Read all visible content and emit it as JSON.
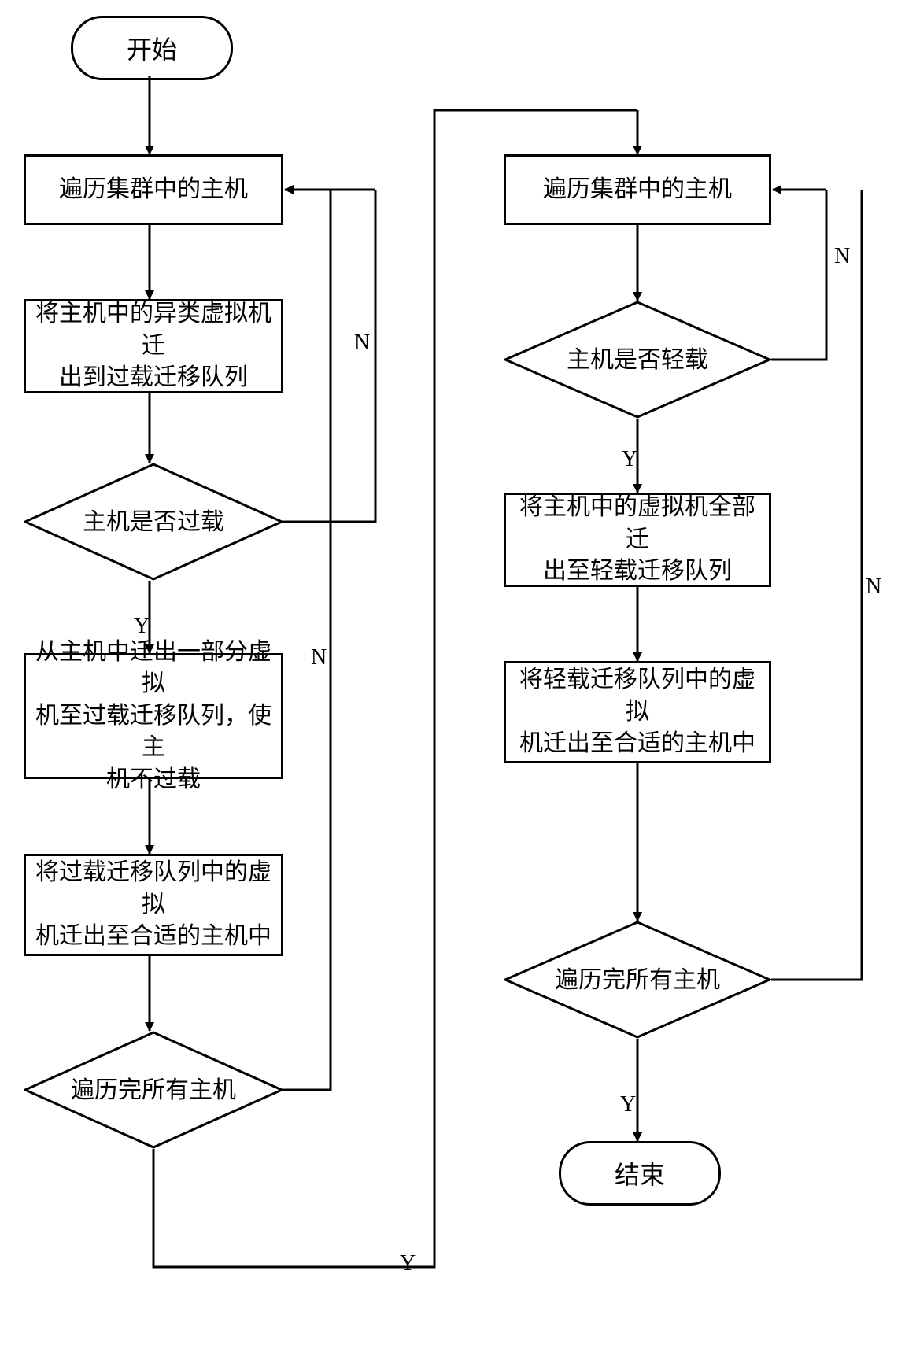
{
  "nodes": {
    "start": "开始",
    "end": "结束",
    "l_traverse": "遍历集群中的主机",
    "l_move_hetero": "将主机中的异类虚拟机迁\n出到过载迁移队列",
    "l_overloaded": "主机是否过载",
    "l_move_some": "从主机中迁出一部分虚拟\n机至过载迁移队列，使主\n机不过载",
    "l_move_overload_q": "将过载迁移队列中的虚拟\n机迁出至合适的主机中",
    "l_done_all": "遍历完所有主机",
    "r_traverse": "遍历集群中的主机",
    "r_lightload": "主机是否轻载",
    "r_move_all": "将主机中的虚拟机全部迁\n出至轻载迁移队列",
    "r_move_light_q": "将轻载迁移队列中的虚拟\n机迁出至合适的主机中",
    "r_done_all": "遍历完所有主机"
  },
  "labels": {
    "Y": "Y",
    "N": "N"
  },
  "chart_data": {
    "type": "flowchart",
    "title": "",
    "start": "start",
    "end": "end",
    "nodes": [
      {
        "id": "start",
        "type": "terminator",
        "text": "开始"
      },
      {
        "id": "l_traverse",
        "type": "process",
        "text": "遍历集群中的主机"
      },
      {
        "id": "l_move_hetero",
        "type": "process",
        "text": "将主机中的异类虚拟机迁出到过载迁移队列"
      },
      {
        "id": "l_overloaded",
        "type": "decision",
        "text": "主机是否过载"
      },
      {
        "id": "l_move_some",
        "type": "process",
        "text": "从主机中迁出一部分虚拟机至过载迁移队列，使主机不过载"
      },
      {
        "id": "l_move_overload_q",
        "type": "process",
        "text": "将过载迁移队列中的虚拟机迁出至合适的主机中"
      },
      {
        "id": "l_done_all",
        "type": "decision",
        "text": "遍历完所有主机"
      },
      {
        "id": "r_traverse",
        "type": "process",
        "text": "遍历集群中的主机"
      },
      {
        "id": "r_lightload",
        "type": "decision",
        "text": "主机是否轻载"
      },
      {
        "id": "r_move_all",
        "type": "process",
        "text": "将主机中的虚拟机全部迁出至轻载迁移队列"
      },
      {
        "id": "r_move_light_q",
        "type": "process",
        "text": "将轻载迁移队列中的虚拟机迁出至合适的主机中"
      },
      {
        "id": "r_done_all",
        "type": "decision",
        "text": "遍历完所有主机"
      },
      {
        "id": "end",
        "type": "terminator",
        "text": "结束"
      }
    ],
    "edges": [
      {
        "from": "start",
        "to": "l_traverse"
      },
      {
        "from": "l_traverse",
        "to": "l_move_hetero"
      },
      {
        "from": "l_move_hetero",
        "to": "l_overloaded"
      },
      {
        "from": "l_overloaded",
        "to": "l_move_some",
        "label": "Y"
      },
      {
        "from": "l_overloaded",
        "to": "l_traverse",
        "label": "N"
      },
      {
        "from": "l_move_some",
        "to": "l_move_overload_q"
      },
      {
        "from": "l_move_overload_q",
        "to": "l_done_all"
      },
      {
        "from": "l_done_all",
        "to": "l_traverse",
        "label": "N"
      },
      {
        "from": "l_done_all",
        "to": "r_traverse",
        "label": "Y"
      },
      {
        "from": "r_traverse",
        "to": "r_lightload"
      },
      {
        "from": "r_lightload",
        "to": "r_move_all",
        "label": "Y"
      },
      {
        "from": "r_lightload",
        "to": "r_traverse",
        "label": "N"
      },
      {
        "from": "r_move_all",
        "to": "r_move_light_q"
      },
      {
        "from": "r_move_light_q",
        "to": "r_done_all"
      },
      {
        "from": "r_done_all",
        "to": "r_traverse",
        "label": "N"
      },
      {
        "from": "r_done_all",
        "to": "end",
        "label": "Y"
      }
    ]
  }
}
